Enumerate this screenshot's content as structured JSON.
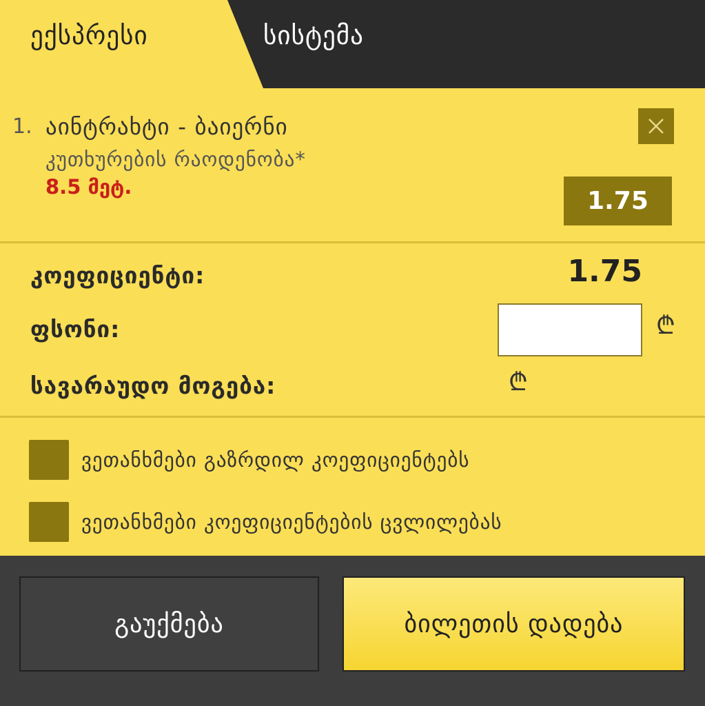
{
  "tabs": {
    "express": "ექსპრესი",
    "system": "სისტემა"
  },
  "bet": {
    "number": "1.",
    "match": "აინტრახტი - ბაიერნი",
    "market": "კუთხურების რაოდენობა*",
    "line": "8.5 მეტ.",
    "odd": "1.75",
    "close_icon": "close-icon"
  },
  "summary": {
    "coefficient_label": "კოეფიციენტი:",
    "coefficient_value": "1.75",
    "stake_label": "ფსონი:",
    "stake_value": "",
    "currency_symbol": "₾",
    "possible_win_label": "სავარაუდო მოგება:"
  },
  "options": {
    "accept_higher_odds": "ვეთანხმები გაზრდილ კოეფიციენტებს",
    "accept_odds_change": "ვეთანხმები კოეფიციენტების ცვლილებას"
  },
  "footer": {
    "cancel_label": "გაუქმება",
    "place_bet_label": "ბილეთის დადება"
  },
  "colors": {
    "background": "#fade55",
    "dark": "#2b2b2b",
    "accent": "#8b7710",
    "alert": "#c8201a",
    "footer": "#3d3d3d"
  }
}
